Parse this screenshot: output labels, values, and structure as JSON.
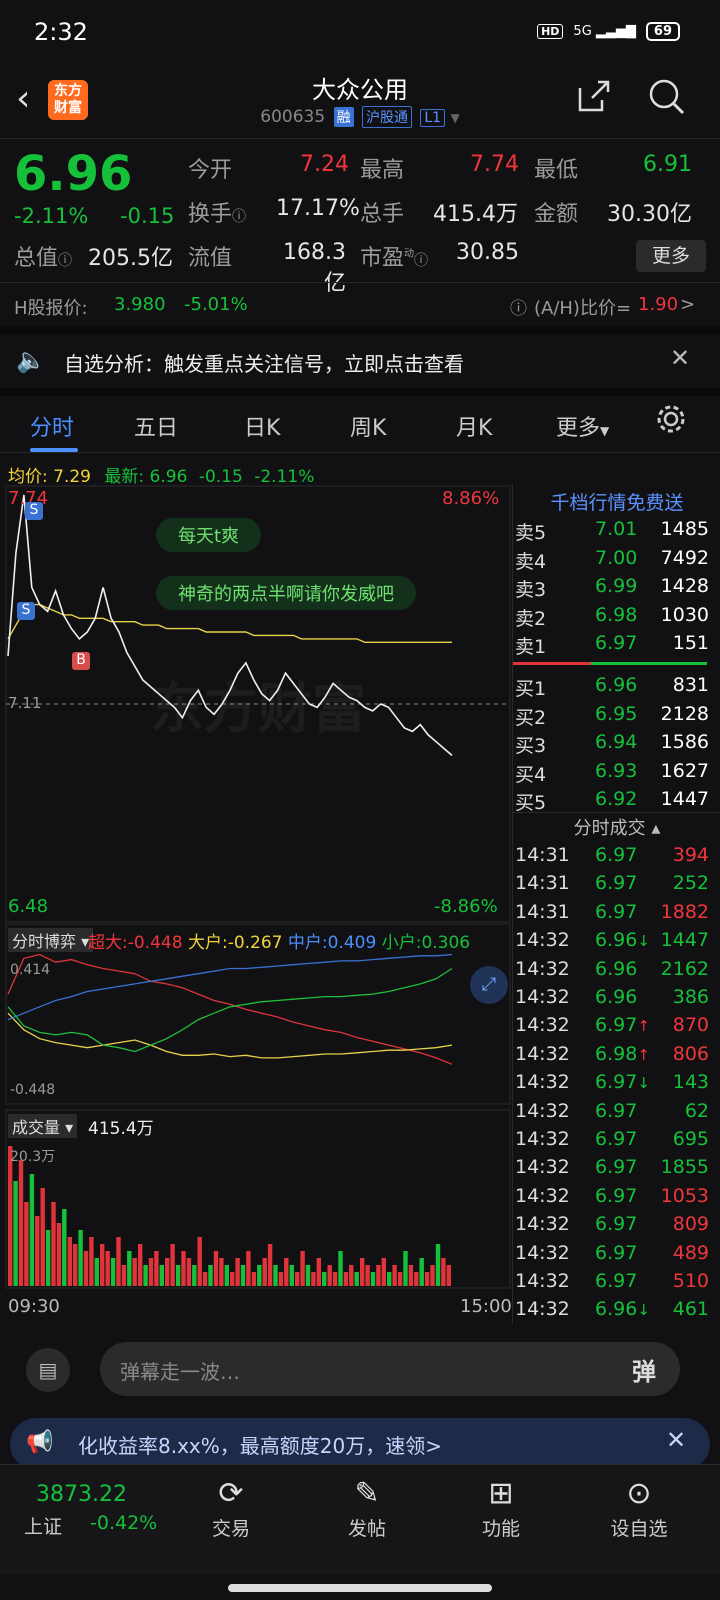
{
  "status": {
    "time": "2:32",
    "hd": "HD",
    "net": "5G",
    "battery": "69"
  },
  "header": {
    "logo": "东方财富",
    "title": "大众公用",
    "code": "600635",
    "tag_rong": "融",
    "tag_hgt": "沪股通",
    "tag_l1": "L1"
  },
  "quote": {
    "price": "6.96",
    "chg_pct": "-2.11%",
    "chg": "-0.15",
    "labels": {
      "open": "今开",
      "high": "最高",
      "low": "最低",
      "turnover": "换手",
      "volume": "总手",
      "amount": "金额",
      "mktcap": "总值",
      "float": "流值",
      "pe": "市盈"
    },
    "open": "7.24",
    "high": "7.74",
    "low": "6.91",
    "turnover": "17.17%",
    "volume": "415.4万",
    "amount": "30.30亿",
    "mktcap": "205.5亿",
    "float": "168.3亿",
    "pe": "30.85",
    "pe_sup": "动",
    "more": "更多"
  },
  "hshare": {
    "label": "H股报价:",
    "price": "3.980",
    "pct": "-5.01%",
    "ratio_label": "(A/H)比价=",
    "ratio": "1.90",
    "arrow": ">"
  },
  "banner": {
    "text": "自选分析：触发重点关注信号，立即点击查看"
  },
  "tabs": [
    "分时",
    "五日",
    "日K",
    "周K",
    "月K",
    "更多"
  ],
  "avgline": {
    "avg_label": "均价:",
    "avg": "7.29",
    "latest_label": "最新:",
    "latest": "6.96",
    "chg": "-0.15",
    "pct": "-2.11%"
  },
  "chart": {
    "top_price": "7.74",
    "top_pct": "8.86%",
    "bottom_price": "6.48",
    "bottom_pct": "-8.86%",
    "mid_price": "7.11",
    "start_time": "09:30",
    "end_time": "15:00",
    "comment1": "每天t爽",
    "comment2": "神奇的两点半啊请你发威吧",
    "marker_s": "S",
    "marker_b": "B",
    "watermark": "东方财富"
  },
  "chart_data": {
    "type": "line",
    "title": "分时",
    "price": [
      7.25,
      7.55,
      7.72,
      7.45,
      7.4,
      7.38,
      7.44,
      7.37,
      7.33,
      7.3,
      7.32,
      7.36,
      7.45,
      7.36,
      7.32,
      7.26,
      7.22,
      7.18,
      7.16,
      7.14,
      7.12,
      7.1,
      7.07,
      7.12,
      7.15,
      7.1,
      7.08,
      7.11,
      7.15,
      7.2,
      7.23,
      7.18,
      7.14,
      7.12,
      7.15,
      7.2,
      7.17,
      7.14,
      7.11,
      7.1,
      7.13,
      7.17,
      7.15,
      7.13,
      7.12,
      7.1,
      7.09,
      7.11,
      7.1,
      7.07,
      7.04,
      7.03,
      7.05,
      7.02,
      7.0,
      6.98,
      6.96
    ],
    "avg_price": [
      7.3,
      7.34,
      7.38,
      7.4,
      7.4,
      7.39,
      7.38,
      7.37,
      7.37,
      7.36,
      7.36,
      7.36,
      7.36,
      7.35,
      7.35,
      7.35,
      7.35,
      7.34,
      7.34,
      7.34,
      7.33,
      7.33,
      7.33,
      7.33,
      7.33,
      7.32,
      7.32,
      7.32,
      7.32,
      7.32,
      7.32,
      7.31,
      7.31,
      7.31,
      7.31,
      7.31,
      7.31,
      7.3,
      7.3,
      7.3,
      7.3,
      7.3,
      7.3,
      7.3,
      7.3,
      7.29,
      7.29,
      7.29,
      7.29,
      7.29,
      7.29,
      7.29,
      7.29,
      7.29,
      7.29,
      7.29,
      7.29
    ],
    "ylim": [
      6.48,
      7.74
    ]
  },
  "flow": {
    "label": "分时博弈",
    "super_label": "超大:",
    "super": "-0.448",
    "big_label": "大户:",
    "big": "-0.267",
    "mid_label": "中户:",
    "mid": "0.409",
    "small_label": "小户:",
    "small": "0.306",
    "top": "0.414",
    "bottom": "-0.448"
  },
  "flow_data": {
    "super": [
      0.1,
      0.38,
      0.41,
      0.35,
      0.37,
      0.33,
      0.3,
      0.28,
      0.26,
      0.2,
      0.18,
      0.15,
      0.1,
      0.05,
      0.02,
      -0.02,
      -0.05,
      -0.08,
      -0.12,
      -0.15,
      -0.18,
      -0.2,
      -0.24,
      -0.27,
      -0.3,
      -0.33,
      -0.36,
      -0.4,
      -0.45
    ],
    "big": [
      -0.05,
      -0.18,
      -0.25,
      -0.28,
      -0.3,
      -0.32,
      -0.3,
      -0.28,
      -0.26,
      -0.3,
      -0.35,
      -0.38,
      -0.38,
      -0.37,
      -0.39,
      -0.38,
      -0.4,
      -0.4,
      -0.39,
      -0.38,
      -0.37,
      -0.37,
      -0.36,
      -0.35,
      -0.34,
      -0.34,
      -0.33,
      -0.32,
      -0.3
    ],
    "mid": [
      -0.1,
      -0.05,
      0.0,
      0.05,
      0.08,
      0.12,
      0.14,
      0.16,
      0.18,
      0.2,
      0.22,
      0.24,
      0.26,
      0.28,
      0.3,
      0.3,
      0.31,
      0.32,
      0.33,
      0.34,
      0.35,
      0.36,
      0.36,
      0.37,
      0.38,
      0.39,
      0.4,
      0.4,
      0.41
    ],
    "small": [
      0.0,
      -0.15,
      -0.2,
      -0.22,
      -0.2,
      -0.22,
      -0.3,
      -0.32,
      -0.35,
      -0.3,
      -0.25,
      -0.18,
      -0.1,
      -0.05,
      0.0,
      0.02,
      0.04,
      0.05,
      0.06,
      0.07,
      0.08,
      0.08,
      0.09,
      0.1,
      0.12,
      0.15,
      0.18,
      0.22,
      0.3
    ]
  },
  "volume": {
    "label": "成交量",
    "total": "415.4万",
    "max": "20.3万"
  },
  "volume_data": [
    20,
    15,
    18,
    12,
    16,
    10,
    14,
    8,
    12,
    9,
    11,
    7,
    6,
    8,
    5,
    7,
    4,
    6,
    5,
    4,
    7,
    3,
    5,
    4,
    6,
    3,
    4,
    5,
    3,
    4,
    6,
    3,
    5,
    4,
    3,
    7,
    2,
    3,
    5,
    4,
    3,
    2,
    4,
    3,
    5,
    2,
    3,
    4,
    6,
    3,
    2,
    4,
    3,
    2,
    5,
    3,
    2,
    4,
    2,
    3,
    2,
    5,
    2,
    3,
    2,
    4,
    3,
    2,
    3,
    4,
    2,
    3,
    2,
    5,
    3,
    2,
    4,
    2,
    3,
    6,
    4,
    3
  ],
  "orderbook": {
    "header": "千档行情免费送",
    "asks": [
      {
        "label": "卖5",
        "price": "7.01",
        "vol": "1485"
      },
      {
        "label": "卖4",
        "price": "7.00",
        "vol": "7492"
      },
      {
        "label": "卖3",
        "price": "6.99",
        "vol": "1428"
      },
      {
        "label": "卖2",
        "price": "6.98",
        "vol": "1030"
      },
      {
        "label": "卖1",
        "price": "6.97",
        "vol": "151"
      }
    ],
    "bids": [
      {
        "label": "买1",
        "price": "6.96",
        "vol": "831"
      },
      {
        "label": "买2",
        "price": "6.95",
        "vol": "2128"
      },
      {
        "label": "买3",
        "price": "6.94",
        "vol": "1586"
      },
      {
        "label": "买4",
        "price": "6.93",
        "vol": "1627"
      },
      {
        "label": "买5",
        "price": "6.92",
        "vol": "1447"
      }
    ],
    "trades_header": "分时成交",
    "trades": [
      {
        "t": "14:31",
        "p": "6.97",
        "v": "394",
        "c": "red",
        "a": ""
      },
      {
        "t": "14:31",
        "p": "6.97",
        "v": "252",
        "c": "green",
        "a": ""
      },
      {
        "t": "14:31",
        "p": "6.97",
        "v": "1882",
        "c": "red",
        "a": ""
      },
      {
        "t": "14:32",
        "p": "6.96",
        "v": "1447",
        "c": "green",
        "a": "↓"
      },
      {
        "t": "14:32",
        "p": "6.96",
        "v": "2162",
        "c": "green",
        "a": ""
      },
      {
        "t": "14:32",
        "p": "6.96",
        "v": "386",
        "c": "green",
        "a": ""
      },
      {
        "t": "14:32",
        "p": "6.97",
        "v": "870",
        "c": "red",
        "a": "↑"
      },
      {
        "t": "14:32",
        "p": "6.98",
        "v": "806",
        "c": "red",
        "a": "↑"
      },
      {
        "t": "14:32",
        "p": "6.97",
        "v": "143",
        "c": "green",
        "a": "↓"
      },
      {
        "t": "14:32",
        "p": "6.97",
        "v": "62",
        "c": "green",
        "a": ""
      },
      {
        "t": "14:32",
        "p": "6.97",
        "v": "695",
        "c": "green",
        "a": ""
      },
      {
        "t": "14:32",
        "p": "6.97",
        "v": "1855",
        "c": "green",
        "a": ""
      },
      {
        "t": "14:32",
        "p": "6.97",
        "v": "1053",
        "c": "red",
        "a": ""
      },
      {
        "t": "14:32",
        "p": "6.97",
        "v": "809",
        "c": "red",
        "a": ""
      },
      {
        "t": "14:32",
        "p": "6.97",
        "v": "489",
        "c": "red",
        "a": ""
      },
      {
        "t": "14:32",
        "p": "6.97",
        "v": "510",
        "c": "red",
        "a": ""
      },
      {
        "t": "14:32",
        "p": "6.96",
        "v": "461",
        "c": "green",
        "a": "↓"
      }
    ]
  },
  "comment": {
    "placeholder": "弹幕走一波…",
    "send": "弹"
  },
  "ad": {
    "text": "化收益率8.xx%，最高额度20万，速领>"
  },
  "bottom": {
    "index_value": "3873.22",
    "index_name": "上证",
    "index_pct": "-0.42%",
    "nav": [
      "交易",
      "发帖",
      "功能",
      "设自选"
    ]
  }
}
